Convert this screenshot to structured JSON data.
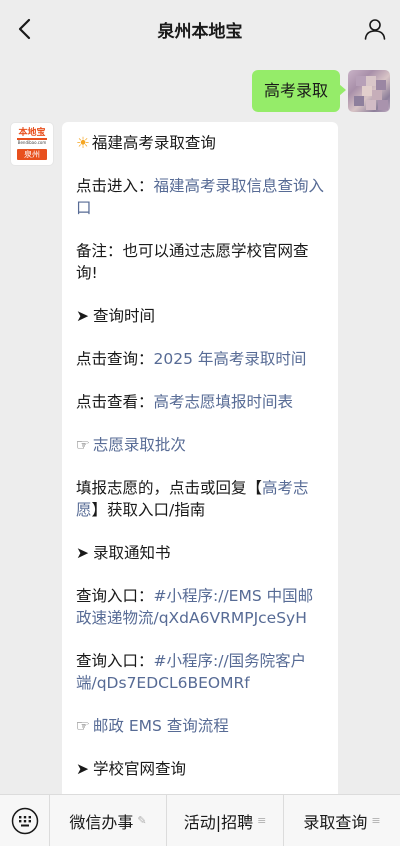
{
  "header": {
    "title": "泉州本地宝",
    "back_icon": "chevron-left-icon",
    "profile_icon": "person-icon"
  },
  "user_message": {
    "text": "高考录取"
  },
  "bot_avatar": {
    "logo_text": "本地宝",
    "logo_url": "Bendibao.com",
    "city": "泉州"
  },
  "bot_message": {
    "title": "福建高考录取查询",
    "p1_prefix": "点击进入：",
    "p1_link": "福建高考录取信息查询入口",
    "p2": "备注：也可以通过志愿学校官网查询!",
    "s1": "查询时间",
    "p3_prefix": "点击查询：",
    "p3_link": "2025 年高考录取时间",
    "p4_prefix": "点击查看：",
    "p4_link": "高考志愿填报时间表",
    "p5_link": "志愿录取批次",
    "p6_prefix": "填报志愿的，点击或回复【",
    "p6_link": "高考志愿",
    "p6_suffix": "】获取入口/指南",
    "s2": "录取通知书",
    "p7_prefix": "查询入口：",
    "p7_link": "#小程序://EMS 中国邮政速递物流/qXdA6VRMPJceSyH",
    "p8_prefix": "查询入口：",
    "p8_link": "#小程序://国务院客户端/qDs7EDCL6BEOMRf",
    "p9_link": "邮政 EMS 查询流程",
    "s3": "学校官网查询"
  },
  "menubar": {
    "keyboard_icon": "keyboard-icon",
    "items": [
      {
        "label": "微信办事",
        "icon": "pencil-icon"
      },
      {
        "label": "活动|招聘",
        "icon": "menu-lines-icon"
      },
      {
        "label": "录取查询",
        "icon": "menu-lines-icon"
      }
    ]
  },
  "colors": {
    "background": "#ededed",
    "user_bubble": "#95ec69",
    "link": "#576b95",
    "brand": "#e8501e"
  }
}
